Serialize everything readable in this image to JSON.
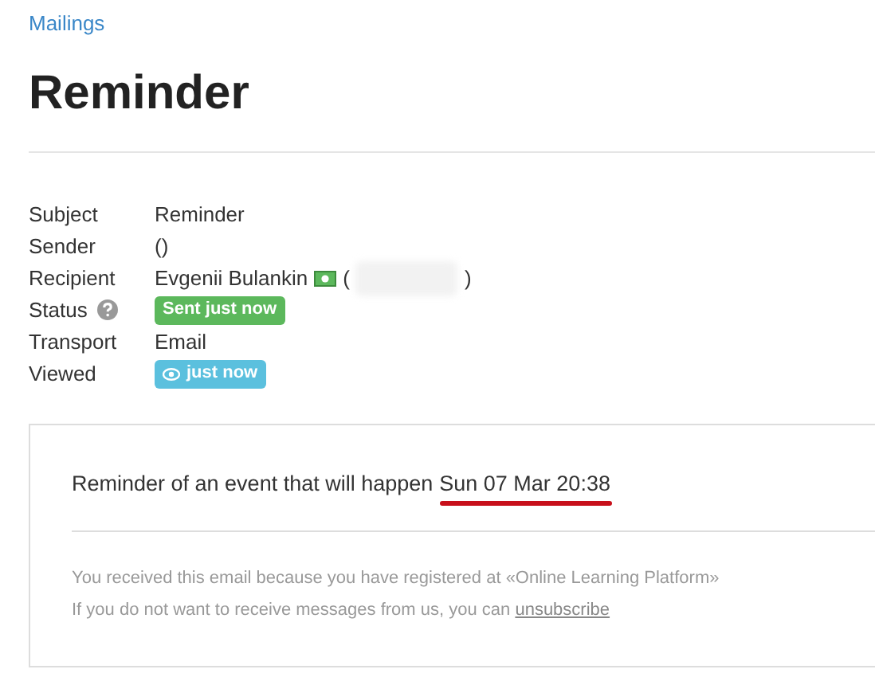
{
  "breadcrumb": "Mailings",
  "title": "Reminder",
  "fields": [
    {
      "label": "Subject",
      "kind": "text",
      "value": "Reminder"
    },
    {
      "label": "Sender",
      "kind": "text",
      "value": "()"
    },
    {
      "label": "Recipient",
      "kind": "recipient",
      "value": "Evgenii Bulankin",
      "open": "(",
      "close": ")"
    },
    {
      "label": "Status",
      "kind": "status",
      "value": "Sent just now",
      "color": "#5cb85c"
    },
    {
      "label": "Transport",
      "kind": "text",
      "value": "Email"
    },
    {
      "label": "Viewed",
      "kind": "viewed",
      "value": "just now",
      "color": "#5bc0de"
    }
  ],
  "message": {
    "text": "Reminder of an event that will happen",
    "date": "Sun 07 Mar 20:38",
    "footer": "You received this email because you have registered at «Online Learning Platform»",
    "unsubscribe_text": "If you do not want to receive messages from us, you can",
    "unsubscribe_link": "unsubscribe"
  }
}
